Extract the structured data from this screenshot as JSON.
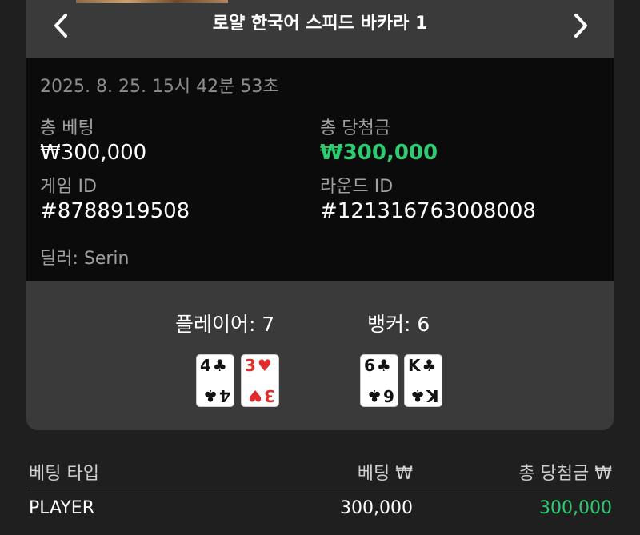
{
  "header": {
    "title": "로얄 한국어 스피드 바카라 1"
  },
  "details": {
    "datetime": "2025. 8. 25. 15시 42분 53초",
    "total_bet_label": "총 베팅",
    "total_bet_value": "₩300,000",
    "total_win_label": "총 당첨금",
    "total_win_value": "₩300,000",
    "game_id_label": "게임 ID",
    "game_id_value": "#8788919508",
    "round_id_label": "라운드 ID",
    "round_id_value": "#121316763008008",
    "dealer": "딜러: Serin"
  },
  "result": {
    "player_label": "플레이어: 7",
    "banker_label": "뱅커: 6",
    "player_cards": [
      {
        "rank": "4",
        "suit": "♣",
        "color": "#111111"
      },
      {
        "rank": "3",
        "suit": "♥",
        "color": "#e02c2c"
      }
    ],
    "banker_cards": [
      {
        "rank": "6",
        "suit": "♣",
        "color": "#111111"
      },
      {
        "rank": "K",
        "suit": "♣",
        "color": "#111111"
      }
    ]
  },
  "bets_table": {
    "headers": [
      "베팅 타입",
      "베팅 ₩",
      "총 당첨금 ₩"
    ],
    "rows": [
      {
        "type": "PLAYER",
        "bet": "300,000",
        "win": "300,000"
      }
    ]
  },
  "colors": {
    "win_green": "#2ecc71",
    "panel": "#3a3a3a",
    "info_bg": "#0b0b0b",
    "page_bg": "#1f1f1f"
  }
}
